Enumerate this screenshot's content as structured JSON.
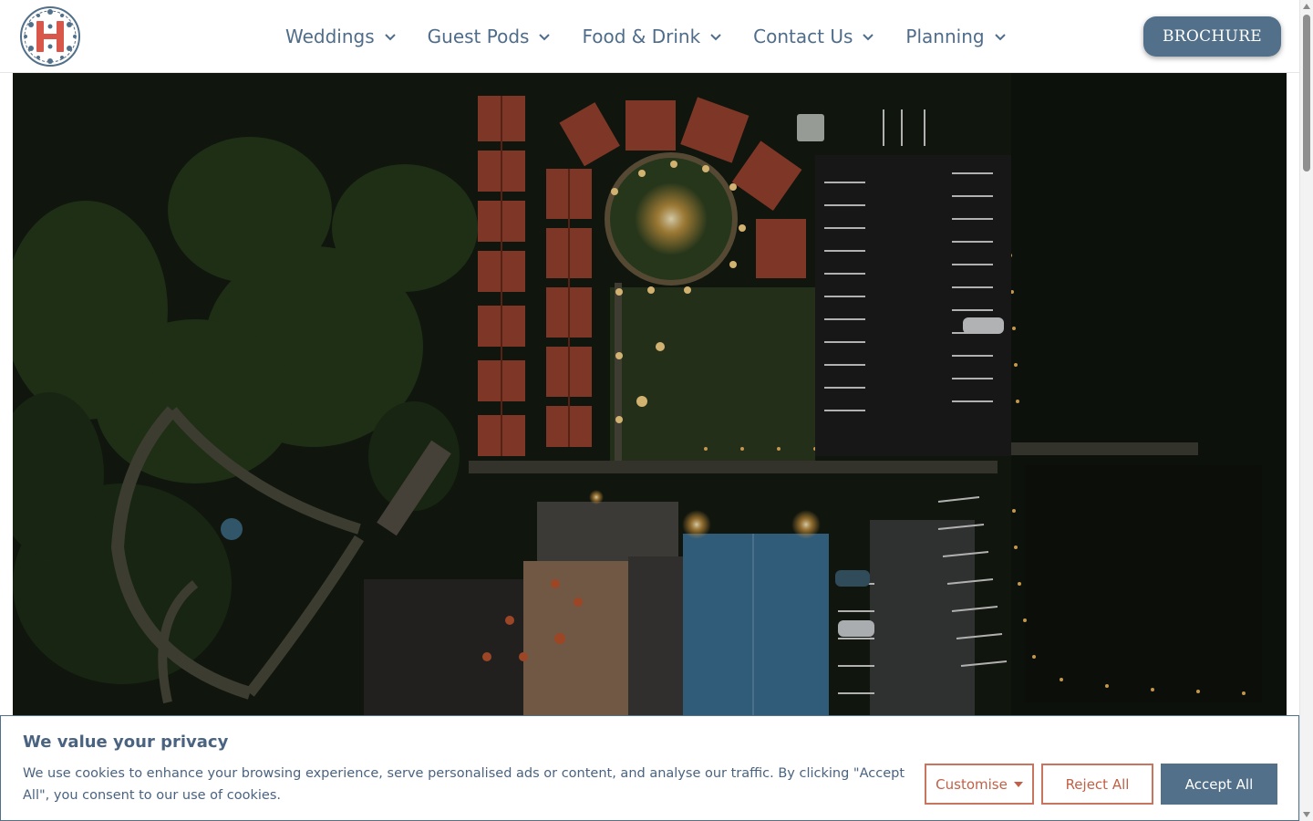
{
  "header": {
    "logo_alt": "H",
    "nav": [
      {
        "label": "Weddings"
      },
      {
        "label": "Guest Pods"
      },
      {
        "label": "Food & Drink"
      },
      {
        "label": "Contact Us"
      },
      {
        "label": "Planning"
      }
    ],
    "brochure_label": "BROCHURE"
  },
  "hero": {
    "image_icon": "aerial-venue-photo"
  },
  "cookie_banner": {
    "title": "We value your privacy",
    "text": "We use cookies to enhance your browsing experience, serve personalised ads or content, and analyse our traffic. By clicking \"Accept All\", you consent to our use of cookies.",
    "customise_label": "Customise",
    "reject_label": "Reject All",
    "accept_label": "Accept All"
  },
  "colors": {
    "brand": "#52708a",
    "nav_text": "#4f6d8a",
    "accent_outline": "#c9745e",
    "logo_red": "#d9564a"
  }
}
